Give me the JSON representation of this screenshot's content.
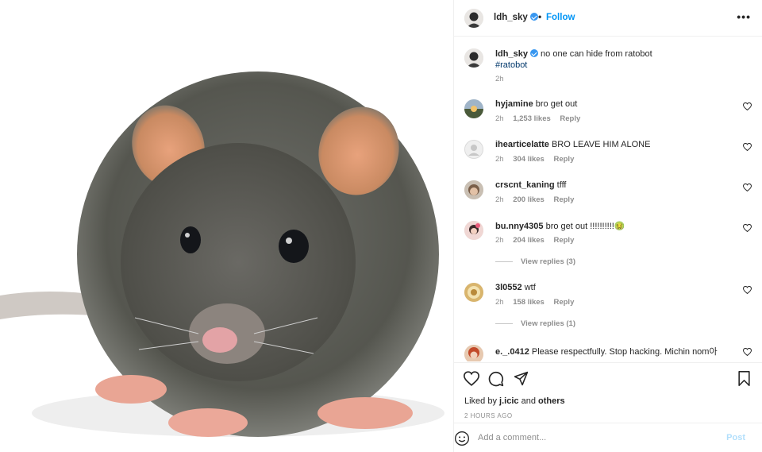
{
  "post": {
    "username": "ldh_sky",
    "follow_label": "Follow",
    "dot": "•",
    "more_label": "•••",
    "caption_text": "no one can hide from ratobot",
    "caption_hashtag": "#ratobot",
    "caption_time": "2h",
    "image_alt": "close-up photo of a grey rat"
  },
  "comments": [
    {
      "username": "hyjamine",
      "text": "bro get out",
      "time": "2h",
      "likes": "1,253 likes",
      "reply": "Reply"
    },
    {
      "username": "ihearticelatte",
      "text": "BRO LEAVE HIM ALONE",
      "time": "2h",
      "likes": "304 likes",
      "reply": "Reply"
    },
    {
      "username": "crscnt_kaning",
      "text": "tfff",
      "time": "2h",
      "likes": "200 likes",
      "reply": "Reply"
    },
    {
      "username": "bu.nny4305",
      "text": "bro get out !!!!!!!!!!🤢",
      "time": "2h",
      "likes": "204 likes",
      "reply": "Reply",
      "view_replies": "View replies (3)"
    },
    {
      "username": "3l0552",
      "text": "wtf",
      "time": "2h",
      "likes": "158 likes",
      "reply": "Reply",
      "view_replies": "View replies (1)"
    },
    {
      "username": "e._.0412",
      "text": "Please respectfully. Stop hacking. Michin nom아",
      "time": "",
      "likes": "",
      "reply": ""
    }
  ],
  "actions": {
    "liked_prefix": "Liked by",
    "liked_user": "j.icic",
    "liked_and": "and",
    "liked_others": "others",
    "date": "2 HOURS AGO"
  },
  "add_comment": {
    "placeholder": "Add a comment...",
    "post_label": "Post"
  },
  "icons": {
    "verified": "verified-badge-icon",
    "like": "heart-icon",
    "comment": "comment-bubble-icon",
    "share": "paper-plane-icon",
    "save": "bookmark-icon",
    "emoji": "smiley-icon"
  },
  "colors": {
    "link_blue": "#0095f6",
    "hashtag": "#00376b",
    "muted": "#8e8e8e",
    "post_disabled": "#b2dffc"
  }
}
